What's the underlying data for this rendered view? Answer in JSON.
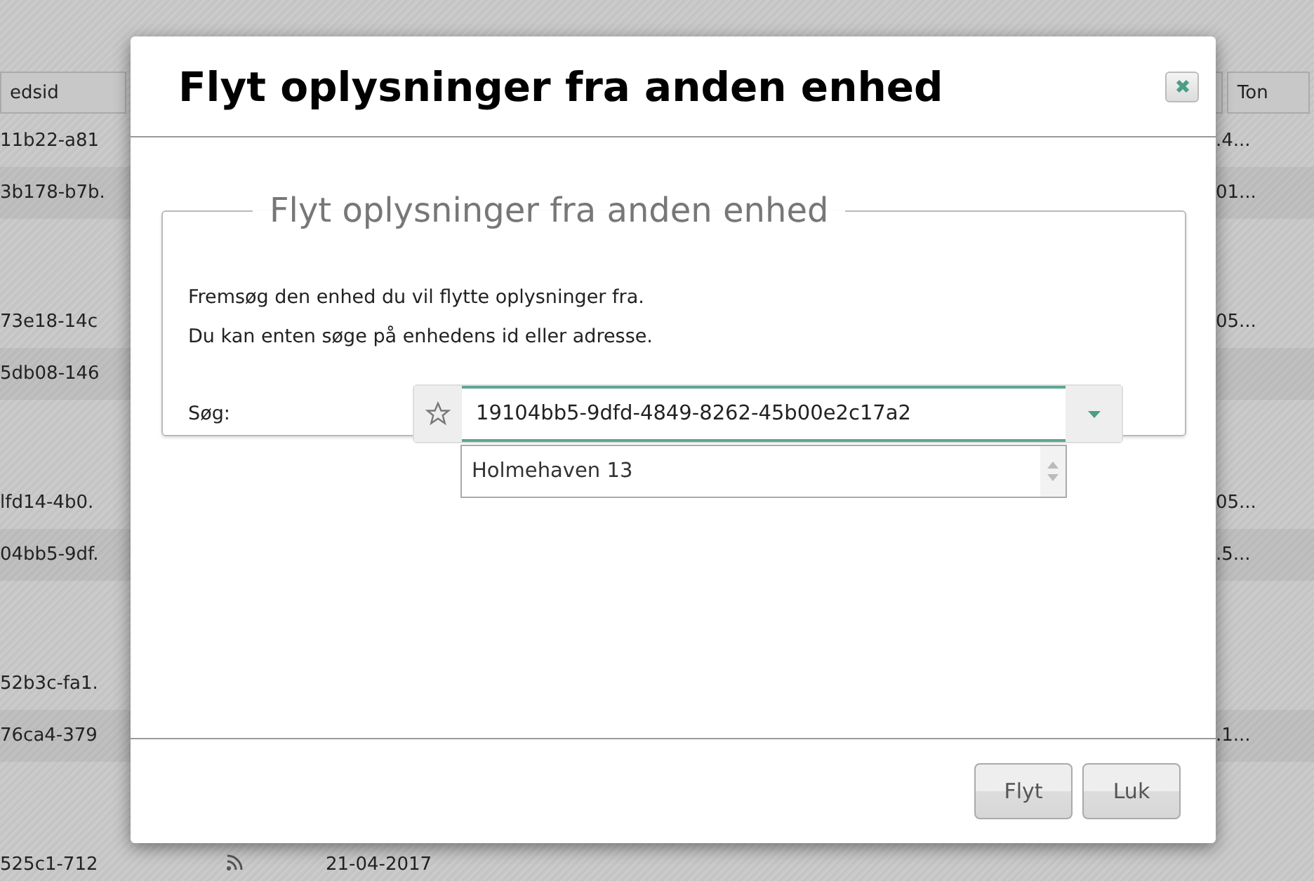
{
  "background_page": {
    "columns": [
      {
        "label": "edsid"
      },
      {},
      {
        "label": "Ton"
      }
    ],
    "row_groups": [
      [
        {
          "id": "11b22-a81",
          "value": ".4..."
        },
        {
          "id": "3b178-b7b.",
          "value": "01..."
        }
      ],
      [
        {
          "id": "73e18-14c",
          "value": "05..."
        },
        {
          "id": "5db08-146"
        }
      ],
      [
        {
          "id": "lfd14-4b0.",
          "value": "05..."
        },
        {
          "id": "04bb5-9df.",
          "value": ".5..."
        }
      ],
      [
        {
          "id": "52b3c-fa1."
        },
        {
          "id": "76ca4-379",
          "value": ".1..."
        }
      ],
      [
        {
          "id": "525c1-712",
          "value": "21-04-2017",
          "kind": "feed"
        }
      ]
    ]
  },
  "dialog": {
    "title": "Flyt oplysninger fra anden enhed",
    "fieldset": {
      "legend": "Flyt oplysninger fra anden enhed",
      "description": [
        "Fremsøg den enhed du vil flytte oplysninger fra.",
        "Du kan enten søge på enhedens id eller adresse."
      ],
      "search": {
        "label": "Søg:",
        "value": "19104bb5-9dfd-4849-8262-45b00e2c17a2",
        "suggestions": [
          "Holmehaven 13"
        ]
      }
    },
    "buttons": [
      "Flyt",
      "Luk"
    ]
  }
}
